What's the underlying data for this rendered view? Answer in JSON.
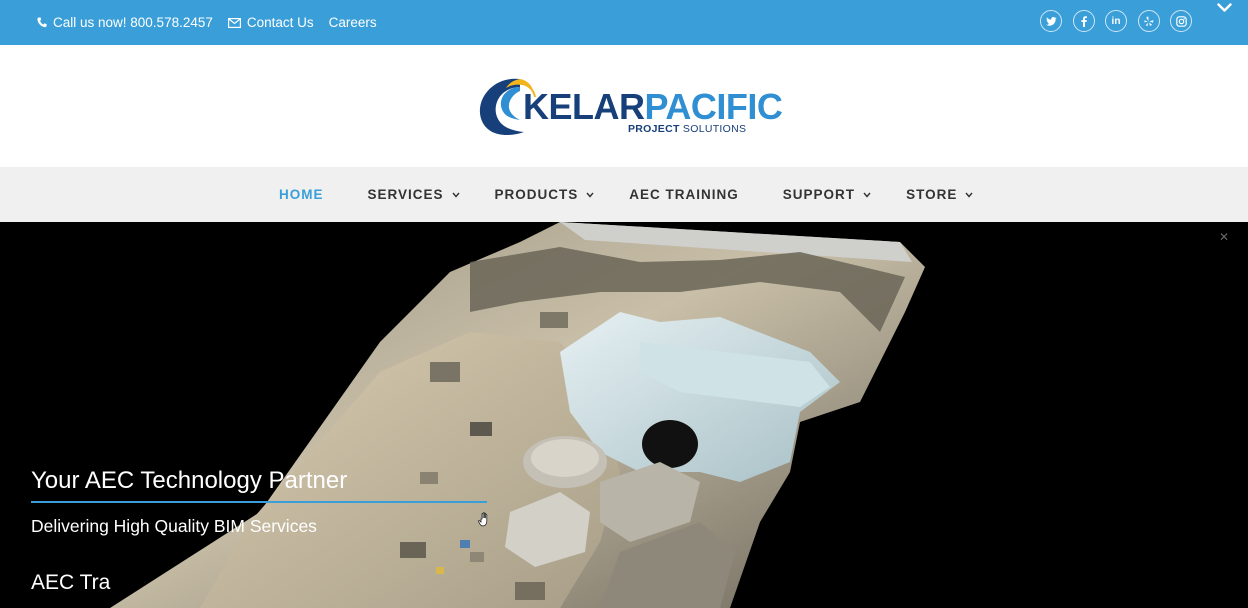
{
  "topbar": {
    "phone": "Call us now! 800.578.2457",
    "contact": "Contact Us",
    "careers": "Careers",
    "social_icons": [
      "twitter-icon",
      "facebook-icon",
      "linkedin-icon",
      "yelp-icon",
      "instagram-icon"
    ],
    "background": "#3a9fd9"
  },
  "logo": {
    "name_part1": "KELAR",
    "name_part2": "PACIFIC",
    "tagline_bold": "PROJECT",
    "tagline_rest": " SOLUTIONS",
    "colors": {
      "dark": "#173f7a",
      "light": "#2f8fd2",
      "accent": "#f2b51b"
    }
  },
  "nav": {
    "items": [
      {
        "label": "HOME",
        "active": true,
        "dropdown": false
      },
      {
        "label": "SERVICES",
        "active": false,
        "dropdown": true
      },
      {
        "label": "PRODUCTS",
        "active": false,
        "dropdown": true
      },
      {
        "label": "AEC TRAINING",
        "active": false,
        "dropdown": false
      },
      {
        "label": "SUPPORT",
        "active": false,
        "dropdown": true
      },
      {
        "label": "STORE",
        "active": false,
        "dropdown": true
      }
    ]
  },
  "hero": {
    "title": "Your AEC Technology Partner",
    "subtitle": "Delivering High Quality BIM Services",
    "rotating_text": "AEC Tra"
  }
}
